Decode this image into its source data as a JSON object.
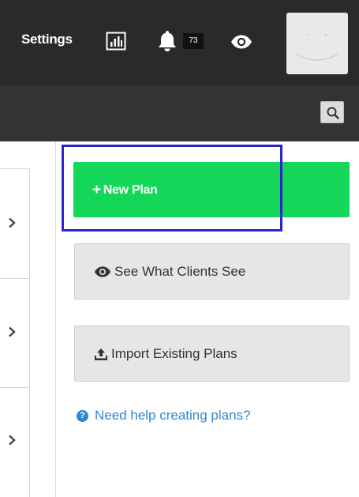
{
  "header": {
    "settings_label": "Settings",
    "notification_count": "73",
    "icons": {
      "stats": "bar-chart-icon",
      "notifications": "bell-icon",
      "preview": "eye-icon",
      "search": "search-icon"
    }
  },
  "actions": {
    "new_plan_label": "New Plan",
    "see_clients_label": "See What Clients See",
    "import_label": "Import Existing Plans",
    "help_label": "Need help creating plans?"
  },
  "colors": {
    "topbar": "#2a2a2a",
    "primary_green": "#14d658",
    "link_blue": "#2f86d1",
    "highlight_border": "#2b25ce"
  }
}
